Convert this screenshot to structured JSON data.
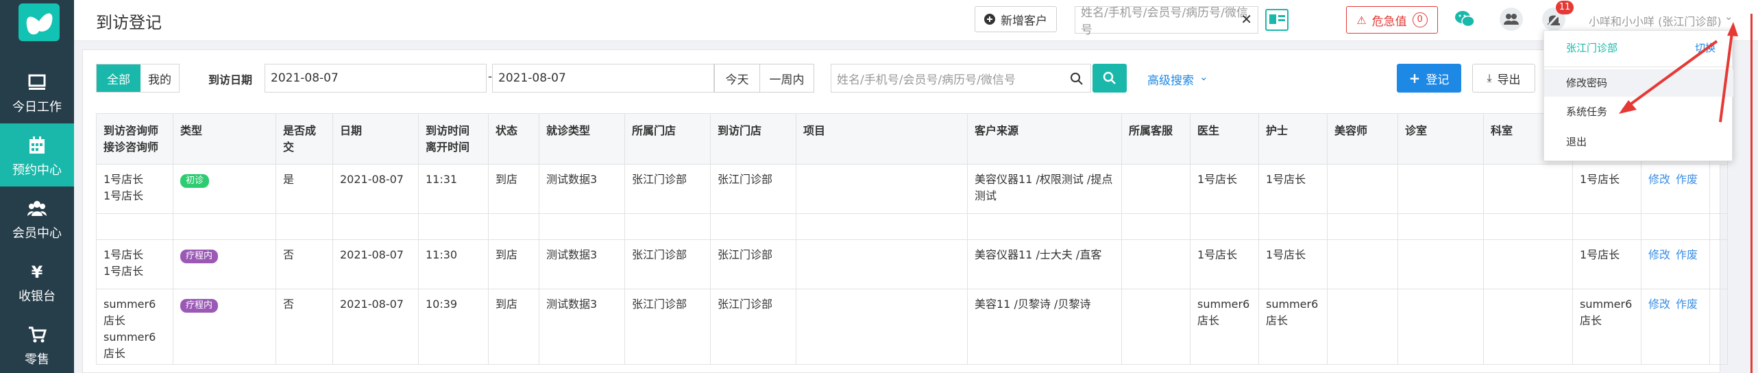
{
  "sidebar": {
    "items": [
      {
        "label": "今日工作",
        "icon": "monitor-icon"
      },
      {
        "label": "预约中心",
        "icon": "calendar-icon",
        "active": true
      },
      {
        "label": "会员中心",
        "icon": "users-icon"
      },
      {
        "label": "收银台",
        "icon": "yen-icon"
      },
      {
        "label": "零售",
        "icon": "cart-icon"
      }
    ]
  },
  "header": {
    "title": "到访登记",
    "add_customer": "新增客户",
    "search_placeholder": "姓名/手机号/会员号/病历号/微信号",
    "danger_label": "危急值",
    "danger_count": "0",
    "notification_count": "11",
    "user": "小咩和小小咩 (张江门诊部)"
  },
  "dropdown": {
    "store": "张江门诊部",
    "switch": "切换",
    "items": [
      "修改密码",
      "系统任务",
      "退出"
    ]
  },
  "filters": {
    "tab_all": "全部",
    "tab_mine": "我的",
    "date_label": "到访日期",
    "date_start": "2021-08-07",
    "date_sep": "-",
    "date_end": "2021-08-07",
    "today": "今天",
    "week": "一周内",
    "search_placeholder": "姓名/手机号/会员号/病历号/微信号",
    "advanced": "高级搜索",
    "register": "登记",
    "export": "导出"
  },
  "table": {
    "headers": [
      "到访咨询师\n接诊咨询师",
      "类型",
      "是否成交",
      "日期",
      "到访时间\n离开时间",
      "状态",
      "就诊类型",
      "所属门店",
      "到访门店",
      "项目",
      "客户来源",
      "所属客服",
      "医生",
      "护士",
      "美容师",
      "诊室",
      "科室",
      "",
      "",
      ""
    ],
    "rows": [
      {
        "consultant": "1号店长\n1号店长",
        "type": "初诊",
        "type_color": "#2ecc71",
        "deal": "是",
        "date": "2021-08-07",
        "time": "11:31",
        "status": "到店",
        "visit_type": "测试数据3",
        "store": "张江门诊部",
        "visit_store": "张江门诊部",
        "project": "",
        "source": "美容仪器11 /权限测试 /提点测试",
        "service": "",
        "doctor": "1号店长",
        "nurse": "1号店长",
        "beautician": "",
        "room": "",
        "dept": "",
        "extra": "1号店长",
        "edit": "修改",
        "void": "作废"
      },
      {
        "consultant": "1号店长\n1号店长",
        "type": "疗程内",
        "type_color": "#9b59b6",
        "deal": "否",
        "date": "2021-08-07",
        "time": "11:30",
        "status": "到店",
        "visit_type": "测试数据3",
        "store": "张江门诊部",
        "visit_store": "张江门诊部",
        "project": "",
        "source": "美容仪器11 /士大夫 /直客",
        "service": "",
        "doctor": "1号店长",
        "nurse": "1号店长",
        "beautician": "",
        "room": "",
        "dept": "",
        "extra": "1号店长",
        "edit": "修改",
        "void": "作废"
      },
      {
        "consultant": "summer6店长\nsummer6店长",
        "type": "疗程内",
        "type_color": "#9b59b6",
        "deal": "否",
        "date": "2021-08-07",
        "time": "10:39",
        "status": "到店",
        "visit_type": "测试数据3",
        "store": "张江门诊部",
        "visit_store": "张江门诊部",
        "project": "",
        "source": "美容11 /贝黎诗 /贝黎诗",
        "service": "",
        "doctor": "summer6店长",
        "nurse": "summer6店长",
        "beautician": "",
        "room": "",
        "dept": "",
        "extra": "summer6店长",
        "edit": "修改",
        "void": "作废"
      }
    ]
  },
  "colors": {
    "sidebar": "#263d4a",
    "accent": "#19b8aa",
    "primary": "#1e88e5",
    "danger": "#e53935",
    "annotation": "#e53935"
  }
}
